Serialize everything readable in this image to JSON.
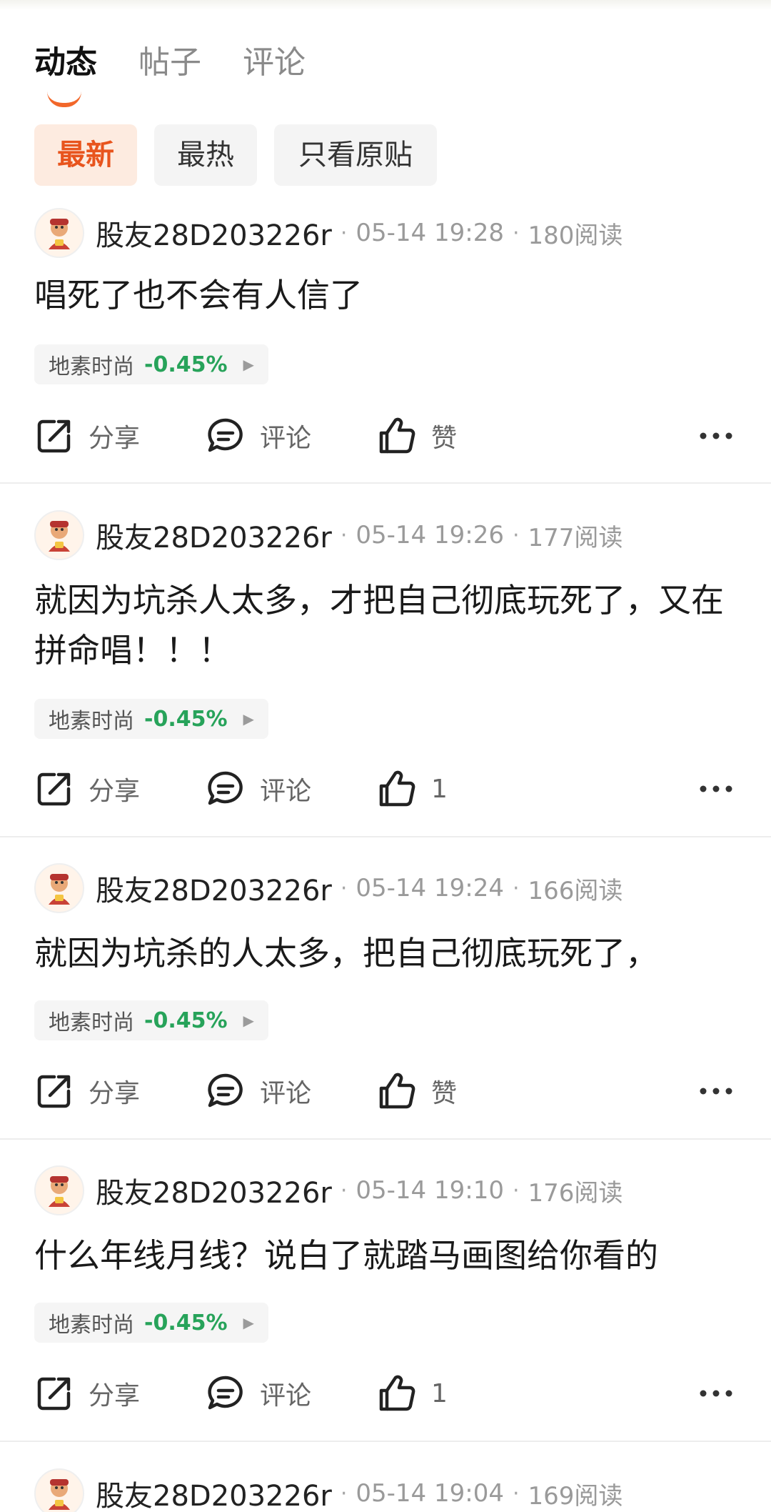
{
  "tabs": [
    {
      "label": "动态"
    },
    {
      "label": "帖子"
    },
    {
      "label": "评论"
    }
  ],
  "filters": [
    {
      "label": "最新"
    },
    {
      "label": "最热"
    },
    {
      "label": "只看原贴"
    }
  ],
  "actions": {
    "share": "分享",
    "comment": "评论"
  },
  "accent_color": "#f2672a",
  "down_color": "#27a35a",
  "posts": [
    {
      "username": "股友28D203226r",
      "time": "05-14 19:28",
      "reads": "180阅读",
      "content": "唱死了也不会有人信了",
      "stock": {
        "name": "地素时尚",
        "change": "-0.45%"
      },
      "like": "赞"
    },
    {
      "username": "股友28D203226r",
      "time": "05-14 19:26",
      "reads": "177阅读",
      "content": "就因为坑杀人太多，才把自己彻底玩死了，又在拼命唱！！！",
      "stock": {
        "name": "地素时尚",
        "change": "-0.45%"
      },
      "like": "1"
    },
    {
      "username": "股友28D203226r",
      "time": "05-14 19:24",
      "reads": "166阅读",
      "content": "就因为坑杀的人太多，把自己彻底玩死了，",
      "stock": {
        "name": "地素时尚",
        "change": "-0.45%"
      },
      "like": "赞"
    },
    {
      "username": "股友28D203226r",
      "time": "05-14 19:10",
      "reads": "176阅读",
      "content": "什么年线月线？说白了就踏马画图给你看的",
      "stock": {
        "name": "地素时尚",
        "change": "-0.45%"
      },
      "like": "1"
    },
    {
      "username": "股友28D203226r",
      "time": "05-14 19:04",
      "reads": "169阅读"
    }
  ]
}
